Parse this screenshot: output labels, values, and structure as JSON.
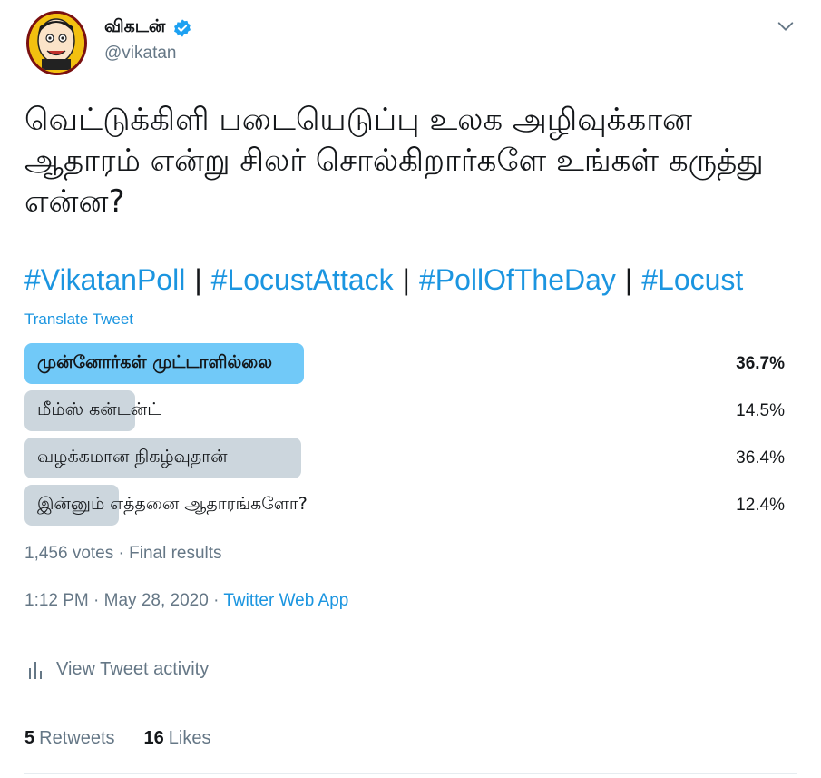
{
  "account": {
    "name": "விகடன்",
    "handle": "@vikatan",
    "verified": true
  },
  "tweet": {
    "text": "வெட்டுக்கிளி படையெடுப்பு உலக அழிவுக்கான ஆதாரம் என்று சிலர் சொல்கிறார்களே உங்கள் கருத்து என்ன?",
    "hashtags": [
      "#VikatanPoll",
      "#LocustAttack",
      "#PollOfTheDay",
      "#Locust"
    ],
    "separator": "|",
    "translate_label": "Translate Tweet"
  },
  "poll": {
    "options": [
      {
        "label": "முன்னோர்கள் முட்டாளில்லை",
        "percent_text": "36.7%",
        "percent": 36.7,
        "winner": true
      },
      {
        "label": "மீம்ஸ் கன்டன்ட்",
        "percent_text": "14.5%",
        "percent": 14.5,
        "winner": false
      },
      {
        "label": "வழக்கமான நிகழ்வுதான்",
        "percent_text": "36.4%",
        "percent": 36.4,
        "winner": false
      },
      {
        "label": "இன்னும் எத்தனை ஆதாரங்களோ?",
        "percent_text": "12.4%",
        "percent": 12.4,
        "winner": false
      }
    ],
    "summary": "1,456 votes · Final results"
  },
  "meta": {
    "time": "1:12 PM",
    "date": "May 28, 2020",
    "source": "Twitter Web App",
    "dot": "·"
  },
  "activity_label": "View Tweet activity",
  "stats": {
    "retweets_count": "5",
    "retweets_label": "Retweets",
    "likes_count": "16",
    "likes_label": "Likes"
  },
  "colors": {
    "accent": "#1b95e0",
    "winner_bar": "#71c9f8",
    "bar": "#ccd6dd",
    "muted": "#657786"
  },
  "icons": {
    "verified": "verified-badge-icon",
    "caret": "chevron-down-icon",
    "activity": "bar-chart-icon"
  }
}
